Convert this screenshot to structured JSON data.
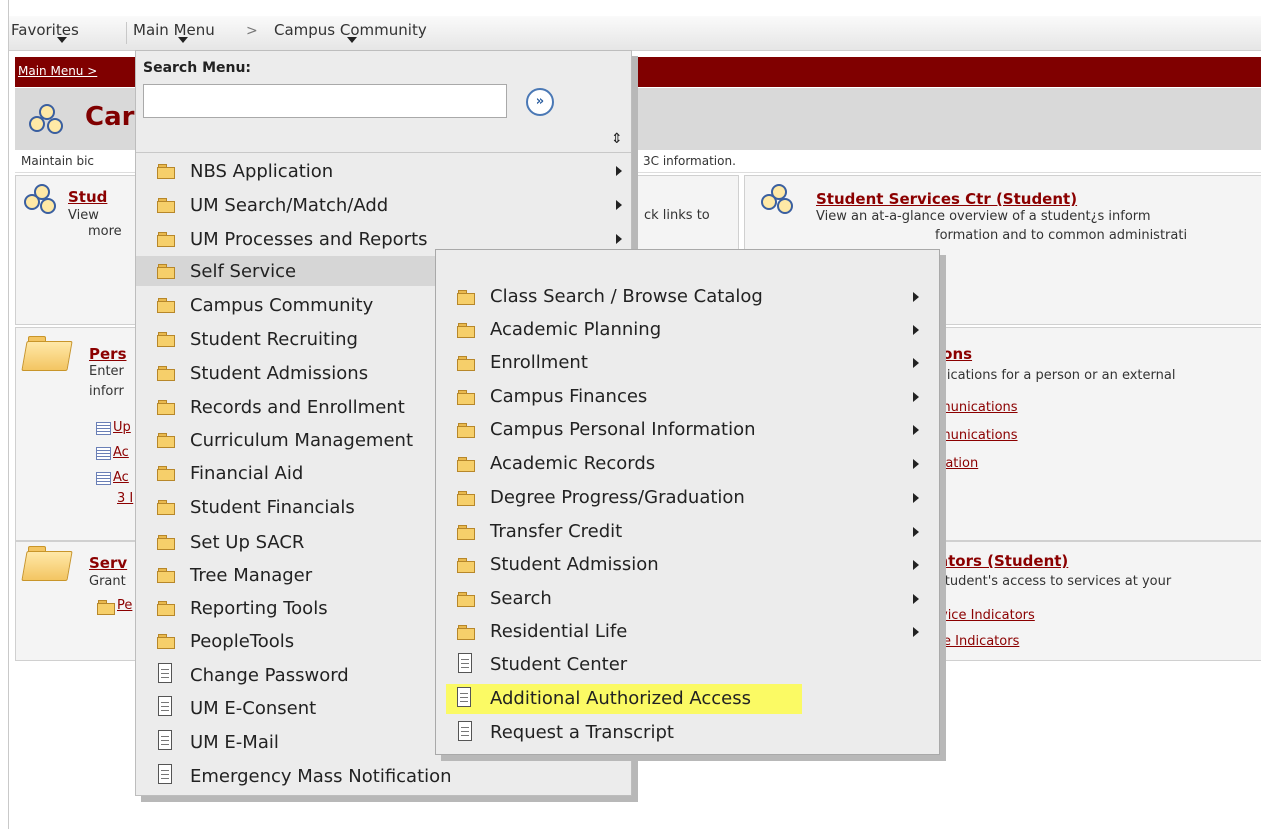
{
  "nav": {
    "favorites": "Favorites",
    "main_menu": "Main Menu",
    "separator": ">",
    "campus_community": "Campus Community"
  },
  "breadcrumb": "Main Menu >",
  "page": {
    "title_visible": "Car",
    "desc_left": "Maintain bic",
    "desc_right": "3C information."
  },
  "panels": {
    "stud_title": "Stud",
    "stud_desc1": "View",
    "stud_desc2": "more",
    "quick_links_fragment": "ck links to",
    "ssc_title": "Student Services Ctr (Student)",
    "ssc_desc1": "View an at-a-glance overview of a student¿s inform",
    "ssc_desc2": "formation and to common administrati",
    "pers_title": "Pers",
    "pers_desc1": "Enter",
    "pers_desc2": "inforr",
    "pers_link1": "Up",
    "pers_link2": "Ac",
    "pers_link3": "Ac",
    "pers_more": "3 I",
    "comm_title": "ions",
    "comm_desc": "inications for a person or an external",
    "comm_link1": "munications",
    "comm_link2": "munications",
    "comm_link3": "ration",
    "serv_title": "Serv",
    "serv_desc": "Grant",
    "serv_link": "Pe",
    "ind_title": "ators (Student)",
    "ind_desc": "student's access to services at your",
    "ind_link1": "vice Indicators",
    "ind_link2": "e Indicators"
  },
  "menu": {
    "search_label": "Search Menu:",
    "search_value": "",
    "go_glyph": "»",
    "sort_glyph": "⇕",
    "items": [
      {
        "label": "NBS Application",
        "icon": "folder-icon",
        "submenu": true
      },
      {
        "label": "UM Search/Match/Add",
        "icon": "folder-icon",
        "submenu": true
      },
      {
        "label": "UM Processes and Reports",
        "icon": "folder-icon",
        "submenu": true
      },
      {
        "label": "Self Service",
        "icon": "folder-icon",
        "submenu": true,
        "selected": true
      },
      {
        "label": "Campus Community",
        "icon": "folder-icon",
        "submenu": true
      },
      {
        "label": "Student Recruiting",
        "icon": "folder-icon",
        "submenu": true
      },
      {
        "label": "Student Admissions",
        "icon": "folder-icon",
        "submenu": true
      },
      {
        "label": "Records and Enrollment",
        "icon": "folder-icon",
        "submenu": true
      },
      {
        "label": "Curriculum Management",
        "icon": "folder-icon",
        "submenu": true
      },
      {
        "label": "Financial Aid",
        "icon": "folder-icon",
        "submenu": true
      },
      {
        "label": "Student Financials",
        "icon": "folder-icon",
        "submenu": true
      },
      {
        "label": "Set Up SACR",
        "icon": "folder-icon",
        "submenu": true
      },
      {
        "label": "Tree Manager",
        "icon": "folder-icon",
        "submenu": true
      },
      {
        "label": "Reporting Tools",
        "icon": "folder-icon",
        "submenu": true
      },
      {
        "label": "PeopleTools",
        "icon": "folder-icon",
        "submenu": true
      },
      {
        "label": "Change Password",
        "icon": "page-icon",
        "submenu": false
      },
      {
        "label": "UM E-Consent",
        "icon": "page-icon",
        "submenu": false
      },
      {
        "label": "UM E-Mail",
        "icon": "page-icon",
        "submenu": false
      },
      {
        "label": "Emergency Mass Notification",
        "icon": "page-icon",
        "submenu": false
      }
    ]
  },
  "submenu": {
    "items": [
      {
        "label": "Class Search / Browse Catalog",
        "icon": "folder-icon",
        "submenu": true
      },
      {
        "label": "Academic Planning",
        "icon": "folder-icon",
        "submenu": true
      },
      {
        "label": "Enrollment",
        "icon": "folder-icon",
        "submenu": true
      },
      {
        "label": "Campus Finances",
        "icon": "folder-icon",
        "submenu": true
      },
      {
        "label": "Campus Personal Information",
        "icon": "folder-icon",
        "submenu": true
      },
      {
        "label": "Academic Records",
        "icon": "folder-icon",
        "submenu": true
      },
      {
        "label": "Degree Progress/Graduation",
        "icon": "folder-icon",
        "submenu": true
      },
      {
        "label": "Transfer Credit",
        "icon": "folder-icon",
        "submenu": true
      },
      {
        "label": "Student Admission",
        "icon": "folder-icon",
        "submenu": true
      },
      {
        "label": "Search",
        "icon": "folder-icon",
        "submenu": true
      },
      {
        "label": "Residential Life",
        "icon": "folder-icon",
        "submenu": true
      },
      {
        "label": "Student Center",
        "icon": "page-icon",
        "submenu": false
      },
      {
        "label": "Additional Authorized Access",
        "icon": "page-icon",
        "submenu": false,
        "highlighted": true
      },
      {
        "label": "Request a Transcript",
        "icon": "page-icon",
        "submenu": false
      }
    ]
  },
  "colors": {
    "brand_maroon": "#800000",
    "link_red": "#8b0000",
    "highlight_yellow": "#fbfa64"
  }
}
